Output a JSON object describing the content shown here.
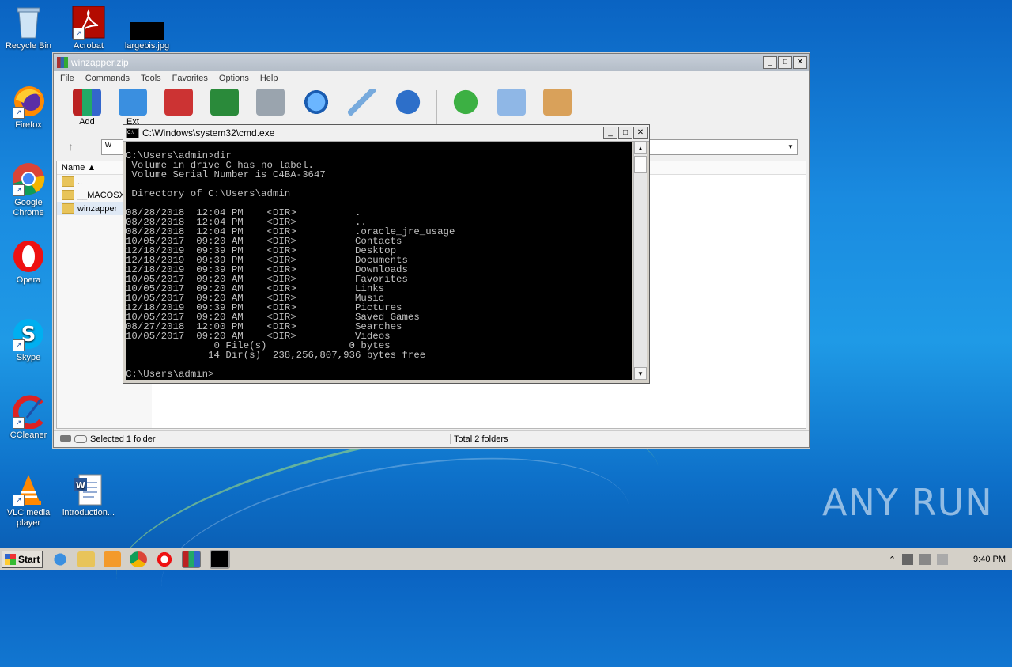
{
  "desktop": {
    "icons": [
      {
        "label": "Recycle Bin",
        "icon": "recycle-bin-icon"
      },
      {
        "label": "Acrobat",
        "icon": "acrobat-icon"
      },
      {
        "label": "largebis.jpg",
        "icon": "image-file-icon"
      },
      {
        "label": "Firefox",
        "icon": "firefox-icon"
      },
      {
        "label": "Google Chrome",
        "icon": "chrome-icon"
      },
      {
        "label": "Opera",
        "icon": "opera-icon"
      },
      {
        "label": "Skype",
        "icon": "skype-icon"
      },
      {
        "label": "CCleaner",
        "icon": "ccleaner-icon"
      },
      {
        "label": "VLC media player",
        "icon": "vlc-icon"
      },
      {
        "label": "introduction...",
        "icon": "word-doc-icon"
      }
    ],
    "watermark": "ANY RUN"
  },
  "winrar": {
    "title": "winzapper.zip",
    "menu": [
      "File",
      "Commands",
      "Tools",
      "Favorites",
      "Options",
      "Help"
    ],
    "toolbar": {
      "add_label": "Add",
      "extract_label": "Ext"
    },
    "address_prefix": "w",
    "column_name": "Name",
    "files": [
      "..",
      "__MACOSX",
      "winzapper"
    ],
    "status_left": "Selected 1 folder",
    "status_right": "Total 2 folders"
  },
  "cmd": {
    "title": "C:\\Windows\\system32\\cmd.exe",
    "output": "C:\\Users\\admin>dir\n Volume in drive C has no label.\n Volume Serial Number is C4BA-3647\n\n Directory of C:\\Users\\admin\n\n08/28/2018  12:04 PM    <DIR>          .\n08/28/2018  12:04 PM    <DIR>          ..\n08/28/2018  12:04 PM    <DIR>          .oracle_jre_usage\n10/05/2017  09:20 AM    <DIR>          Contacts\n12/18/2019  09:39 PM    <DIR>          Desktop\n12/18/2019  09:39 PM    <DIR>          Documents\n12/18/2019  09:39 PM    <DIR>          Downloads\n10/05/2017  09:20 AM    <DIR>          Favorites\n10/05/2017  09:20 AM    <DIR>          Links\n10/05/2017  09:20 AM    <DIR>          Music\n12/18/2019  09:39 PM    <DIR>          Pictures\n10/05/2017  09:20 AM    <DIR>          Saved Games\n08/27/2018  12:00 PM    <DIR>          Searches\n10/05/2017  09:20 AM    <DIR>          Videos\n               0 File(s)              0 bytes\n              14 Dir(s)  238,256,807,936 bytes free\n\nC:\\Users\\admin>"
  },
  "taskbar": {
    "start_label": "Start",
    "clock": "9:40 PM"
  }
}
